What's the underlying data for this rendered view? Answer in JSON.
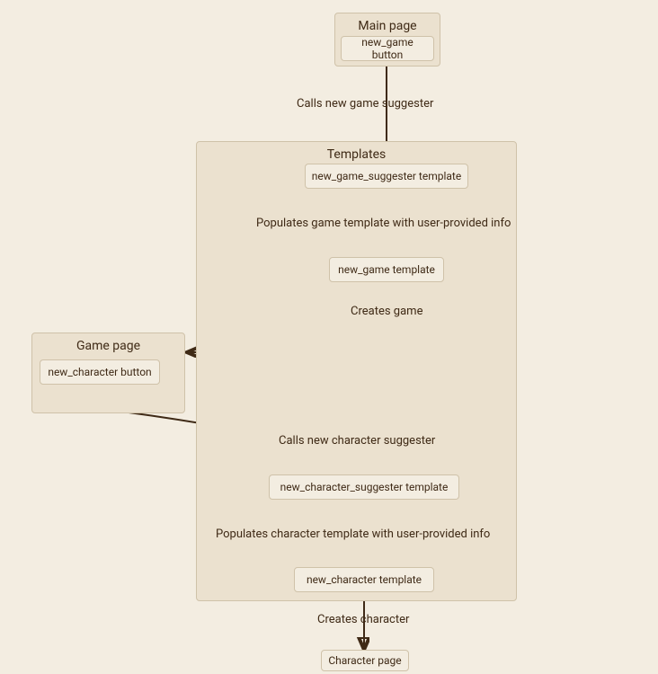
{
  "groups": {
    "main_page": {
      "title": "Main page"
    },
    "templates": {
      "title": "Templates"
    },
    "game_page": {
      "title": "Game page"
    }
  },
  "nodes": {
    "new_game_button": {
      "label": "new_game button"
    },
    "new_game_suggester_template": {
      "label": "new_game_suggester template"
    },
    "new_game_template": {
      "label": "new_game template"
    },
    "new_character_button": {
      "label": "new_character button"
    },
    "new_character_suggester_template": {
      "label": "new_character_suggester template"
    },
    "new_character_template": {
      "label": "new_character template"
    },
    "character_page": {
      "label": "Character page"
    }
  },
  "edges": {
    "calls_new_game_suggester": {
      "label": "Calls new game suggester"
    },
    "populates_game_template": {
      "label": "Populates game template with user-provided info"
    },
    "creates_game": {
      "label": "Creates game"
    },
    "calls_new_character_suggester": {
      "label": "Calls new character suggester"
    },
    "populates_character_template": {
      "label": "Populates character template with user-provided info"
    },
    "creates_character": {
      "label": "Creates character"
    }
  },
  "colors": {
    "background": "#f3ede1",
    "group_bg": "#ebe1cf",
    "border": "#cfc2a9",
    "text": "#3f2a16",
    "arrow": "#3f2a16"
  }
}
